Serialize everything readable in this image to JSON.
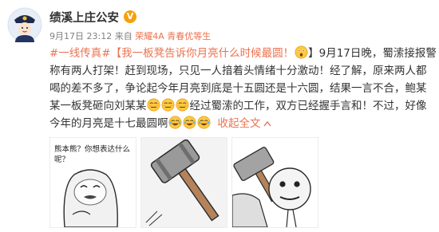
{
  "post": {
    "author": "绩溪上庄公安",
    "verified_icon": "verified-v-badge",
    "time": "9月17日 23:12",
    "source_prefix": "来自",
    "device": "荣耀4A 青春优等生",
    "topic": "#一线传真#",
    "title_link": "【我一板凳告诉你月亮什么时候最圆！",
    "close_bracket": "】",
    "line1_rest": "9月17日晚，蜀溹接报警",
    "line2": "称有两人打架！赶到现场，只见一人揞着头情绪十分激动！经了解，原来两人都",
    "line3": "喝的差不多了，争论起今年月亮到底是十五圆还是十六圆，结果一言不合，鲍某",
    "line4_a": "某一板凳砸向刘某某",
    "line4_b": "经过蜀溹的工作，双方已经握手言和！不过，好像",
    "line5_a": "今年的月亮是十七最圆啊",
    "collapse_link": "收起全文",
    "collapse_icon": "chevron-up-icon",
    "image1_caption_1": "熊本熊？你想表达什么",
    "image1_caption_2": "呢？"
  },
  "colors": {
    "link": "#eb7350",
    "text": "#333333",
    "meta": "#808080",
    "badge": "#f4a10c"
  }
}
